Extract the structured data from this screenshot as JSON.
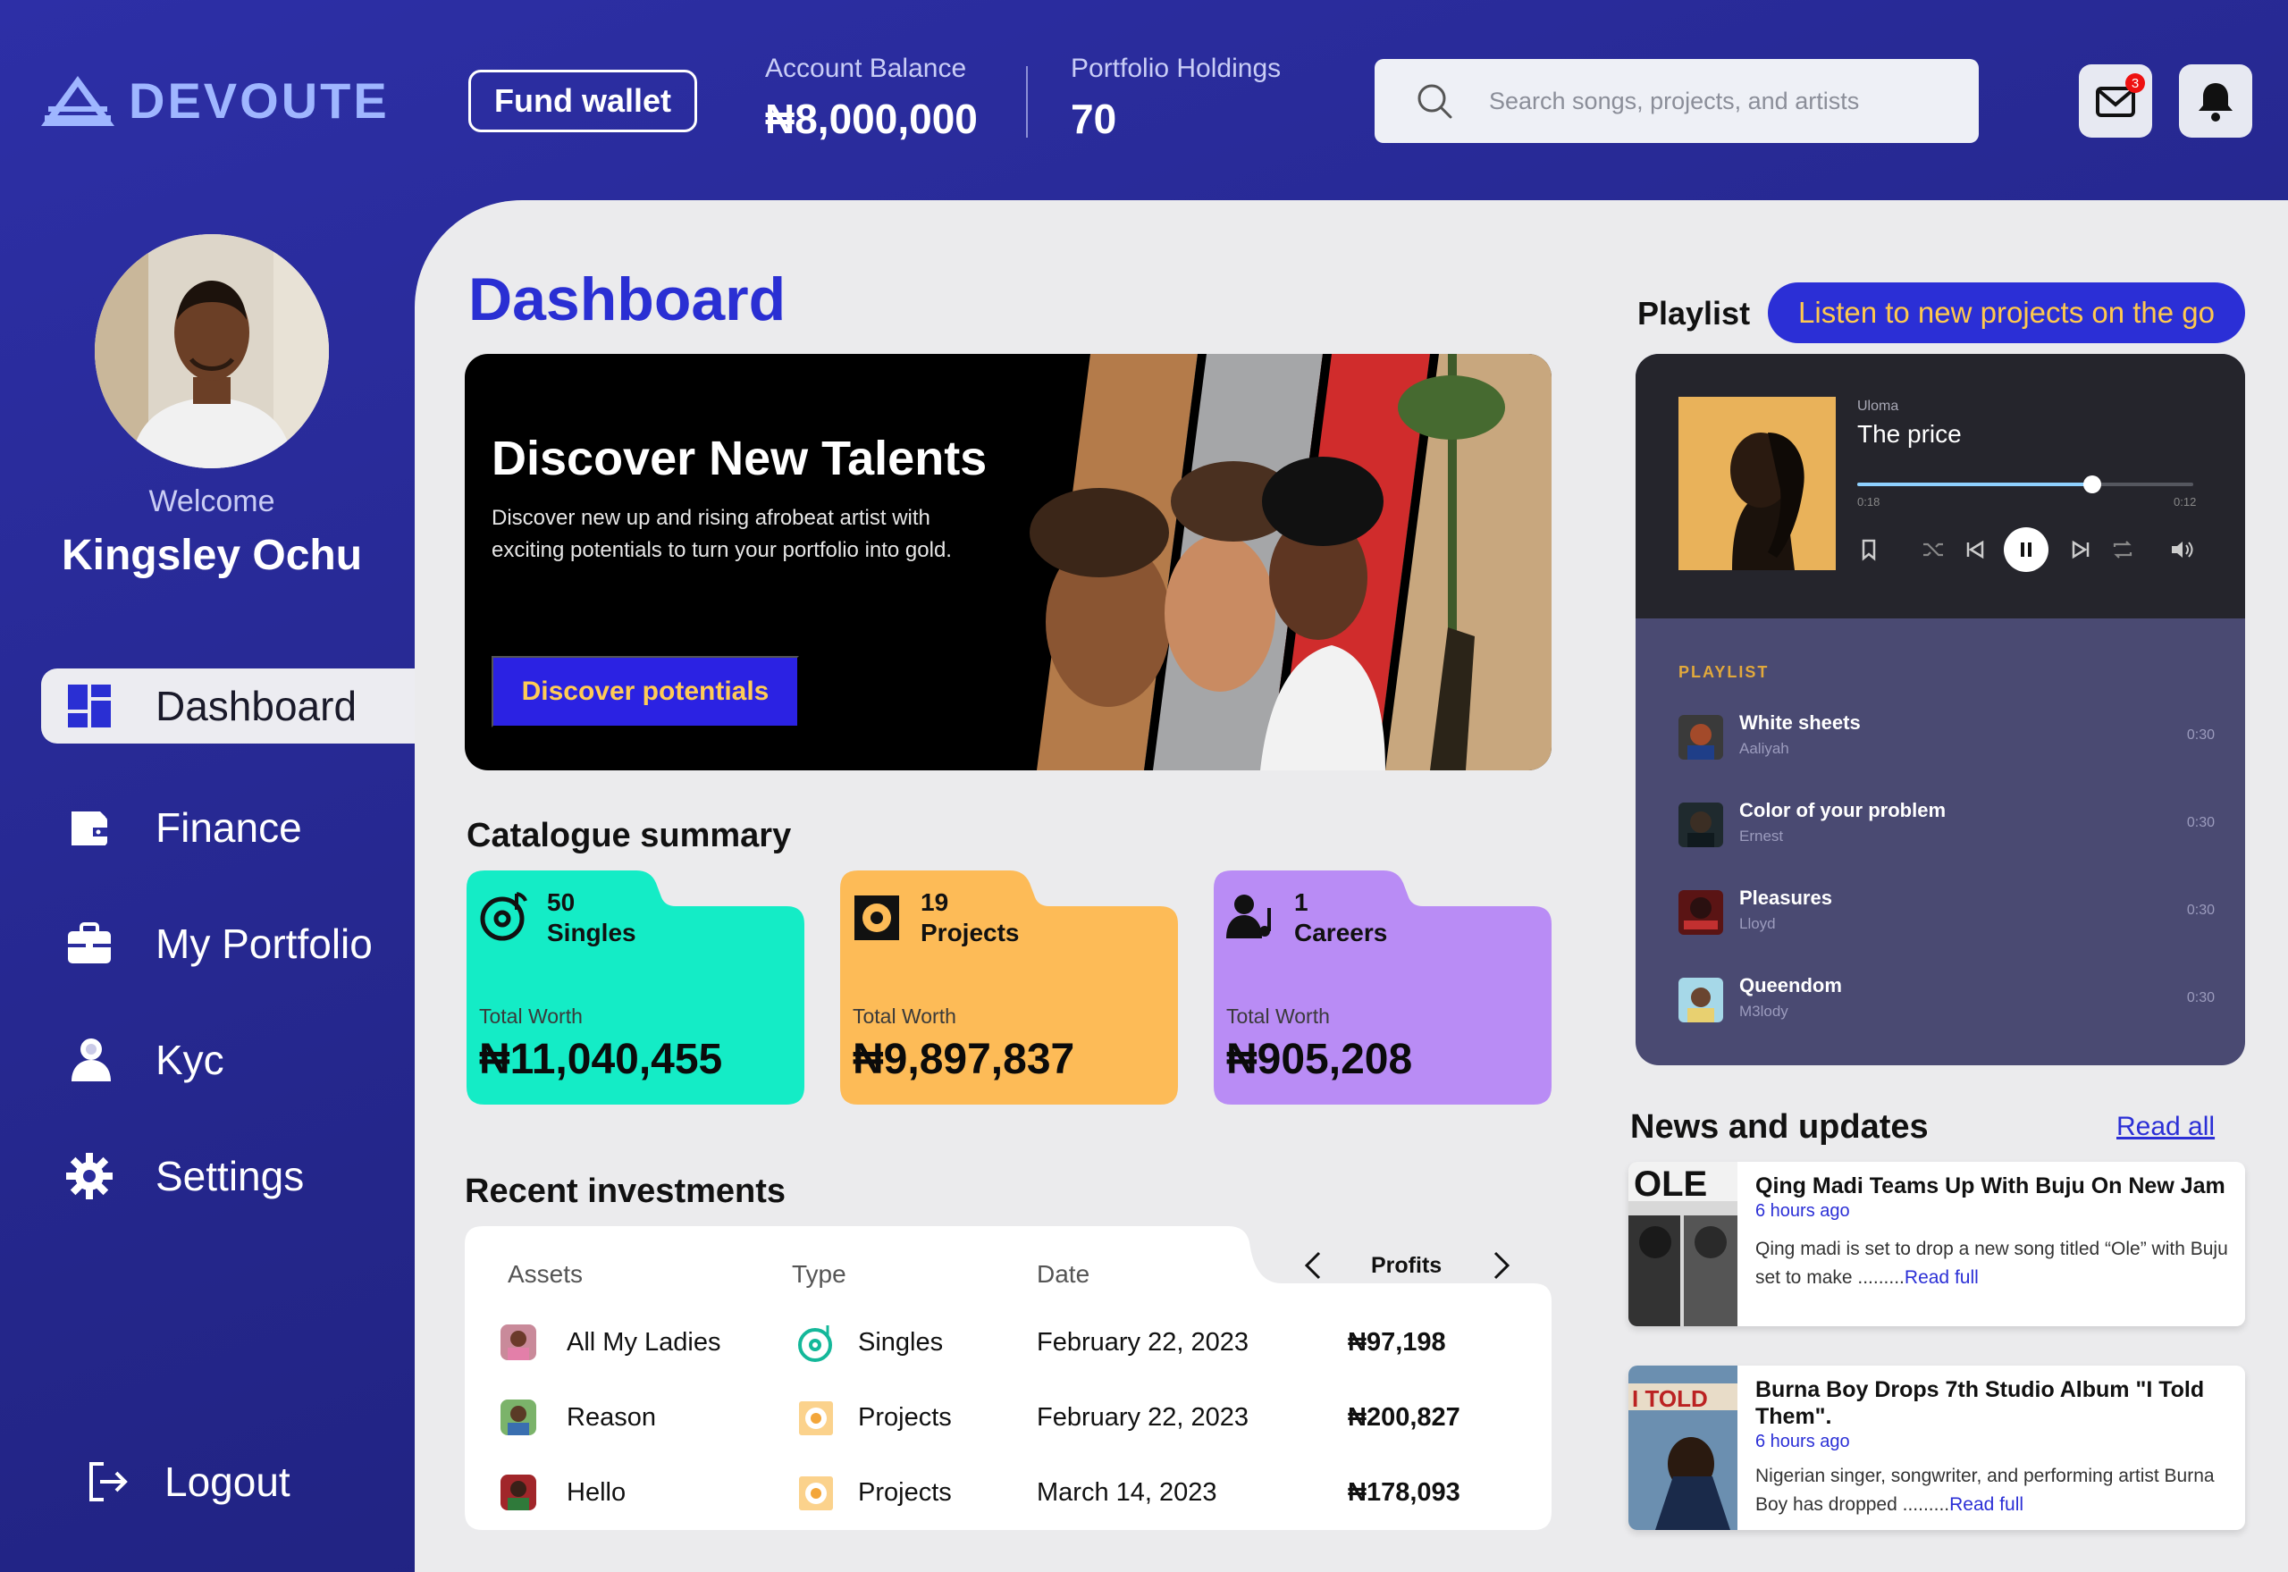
{
  "brand": {
    "name": "DEVOUTE"
  },
  "header": {
    "fund_wallet": "Fund wallet",
    "balance_label": "Account Balance",
    "balance_value": "₦8,000,000",
    "holdings_label": "Portfolio Holdings",
    "holdings_value": "70",
    "search_placeholder": "Search songs, projects, and artists",
    "mail_badge": "3"
  },
  "sidebar": {
    "welcome": "Welcome",
    "user_name": "Kingsley Ochu",
    "items": [
      {
        "label": "Dashboard",
        "icon": "dashboard-icon",
        "active": true
      },
      {
        "label": "Finance",
        "icon": "wallet-icon"
      },
      {
        "label": "My Portfolio",
        "icon": "briefcase-icon"
      },
      {
        "label": "Kyc",
        "icon": "user-icon"
      },
      {
        "label": "Settings",
        "icon": "gear-icon"
      }
    ],
    "logout": "Logout"
  },
  "main": {
    "title": "Dashboard",
    "hero": {
      "title": "Discover New Talents",
      "text": "Discover new up and rising afrobeat artist with exciting potentials to turn your portfolio into gold.",
      "button": "Discover potentials"
    },
    "catalogue_title": "Catalogue summary",
    "catalogue": [
      {
        "count": "50",
        "label": "Singles",
        "worth_label": "Total Worth",
        "worth": "₦11,040,455",
        "color": "#14ecc6"
      },
      {
        "count": "19",
        "label": "Projects",
        "worth_label": "Total Worth",
        "worth": "₦9,897,837",
        "color": "#fdbb57"
      },
      {
        "count": "1",
        "label": "Careers",
        "worth_label": "Total Worth",
        "worth": "₦905,208",
        "color": "#b98cf5"
      }
    ],
    "investments_title": "Recent investments",
    "investments_headers": {
      "assets": "Assets",
      "type": "Type",
      "date": "Date",
      "profits": "Profits"
    },
    "investments": [
      {
        "asset": "All My Ladies",
        "type": "Singles",
        "date": "February 22, 2023",
        "profit": "₦97,198"
      },
      {
        "asset": "Reason",
        "type": "Projects",
        "date": "February 22, 2023",
        "profit": "₦200,827"
      },
      {
        "asset": "Hello",
        "type": "Projects",
        "date": "March 14, 2023",
        "profit": "₦178,093"
      }
    ]
  },
  "playlist": {
    "title": "Playlist",
    "pill": "Listen to new projects on the go",
    "now_playing": {
      "artist": "Uloma",
      "title": "The price",
      "elapsed": "0:18",
      "total": "0:12",
      "progress": 0.7
    },
    "list_label": "PLAYLIST",
    "tracks": [
      {
        "name": "White sheets",
        "artist": "Aaliyah",
        "duration": "0:30"
      },
      {
        "name": "Color of your problem",
        "artist": "Ernest",
        "duration": "0:30"
      },
      {
        "name": "Pleasures",
        "artist": "Lloyd",
        "duration": "0:30"
      },
      {
        "name": "Queendom",
        "artist": "M3lody",
        "duration": "0:30"
      }
    ]
  },
  "news": {
    "title": "News and updates",
    "read_all": "Read all",
    "items": [
      {
        "headline": "Qing Madi Teams Up With Buju On New Jam",
        "time": "6 hours ago",
        "body": "Qing madi is set to drop a new song titled “Ole” with Buju set to make .........",
        "read": "Read full"
      },
      {
        "headline": "Burna Boy Drops 7th Studio Album \"I Told Them\".",
        "time": "6 hours ago",
        "body": "Nigerian singer, songwriter, and performing artist Burna Boy has dropped .........",
        "read": "Read full"
      }
    ]
  }
}
